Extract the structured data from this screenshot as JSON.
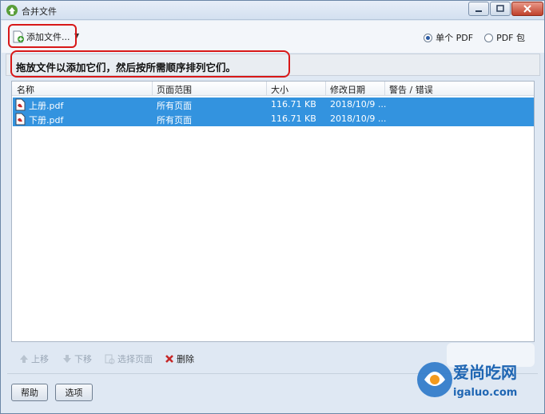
{
  "window": {
    "title": "合并文件"
  },
  "toolbar": {
    "add_files_label": "添加文件...",
    "output_options": [
      {
        "label": "单个 PDF",
        "selected": true
      },
      {
        "label": "PDF 包",
        "selected": false
      }
    ]
  },
  "banner": {
    "text": "拖放文件以添加它们，然后按所需顺序排列它们。"
  },
  "table": {
    "columns": [
      "名称",
      "页面范围",
      "大小",
      "修改日期",
      "警告 / 错误"
    ],
    "rows": [
      {
        "name": "上册.pdf",
        "range": "所有页面",
        "size": "116.71 KB",
        "date": "2018/10/9 ...",
        "warning": "",
        "selected": true
      },
      {
        "name": "下册.pdf",
        "range": "所有页面",
        "size": "116.71 KB",
        "date": "2018/10/9 ...",
        "warning": "",
        "selected": true
      }
    ]
  },
  "list_actions": {
    "move_up": "上移",
    "move_down": "下移",
    "choose_pages": "选择页面",
    "delete": "删除"
  },
  "footer": {
    "help": "帮助",
    "options": "选项"
  },
  "colors": {
    "selection": "#3393df",
    "annotation_red": "#d81818",
    "window_bg": "#dfe8f3"
  },
  "watermark": {
    "text": "爱尚吃网",
    "url": "igaluo.com"
  }
}
